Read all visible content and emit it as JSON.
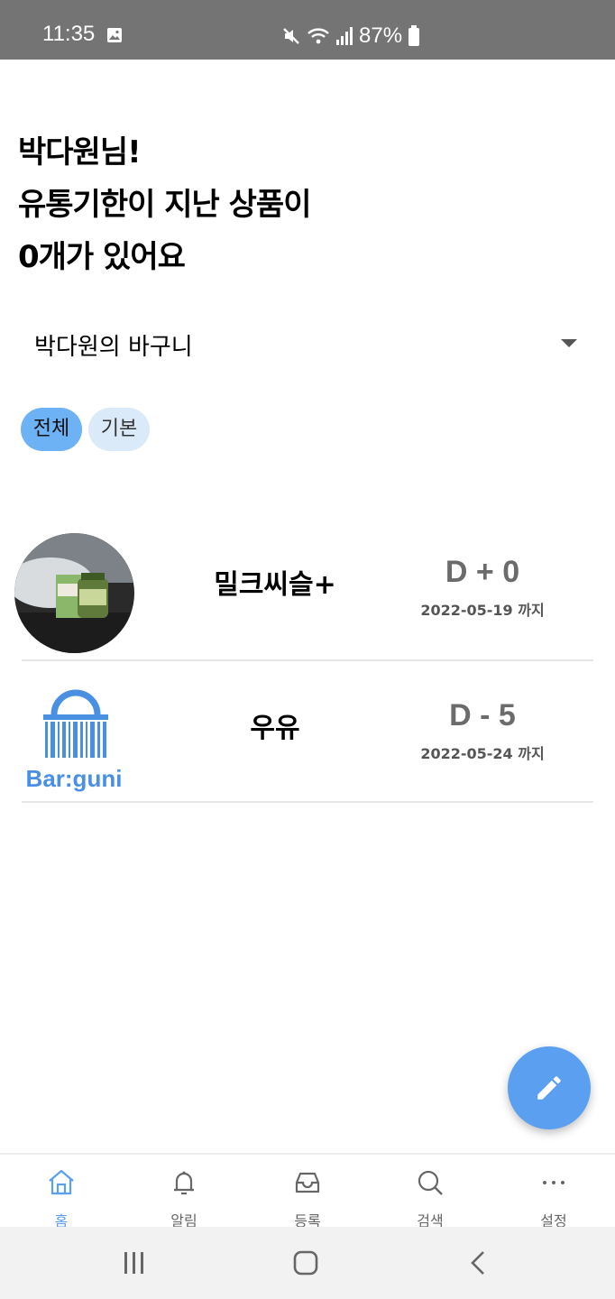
{
  "status_bar": {
    "time": "11:35",
    "battery": "87%",
    "icons": [
      "image-icon",
      "mute-icon",
      "wifi-icon",
      "signal-icon",
      "battery-icon"
    ]
  },
  "greeting": {
    "line1": "박다원님!",
    "line2": "유통기한이 지난 상품이",
    "line3": "0개가 있어요"
  },
  "basket": {
    "selected": "박다원의 바구니"
  },
  "chips": {
    "all": "전체",
    "basic": "기본"
  },
  "products": [
    {
      "name": "밀크씨슬+",
      "dday": "D + 0",
      "date": "2022-05-19 까지",
      "thumb": "supplement-photo"
    },
    {
      "name": "우유",
      "dday": "D - 5",
      "date": "2022-05-24 까지",
      "thumb": "barguni-logo",
      "logo_text": "Bar:guni"
    }
  ],
  "nav": {
    "home": "홈",
    "alarm": "알림",
    "register": "등록",
    "search": "검색",
    "settings": "설정"
  },
  "colors": {
    "accent": "#5a9ff0",
    "chip_active": "#6db2f5",
    "chip_inactive": "#dbeaf9",
    "status_bar": "#747474"
  }
}
